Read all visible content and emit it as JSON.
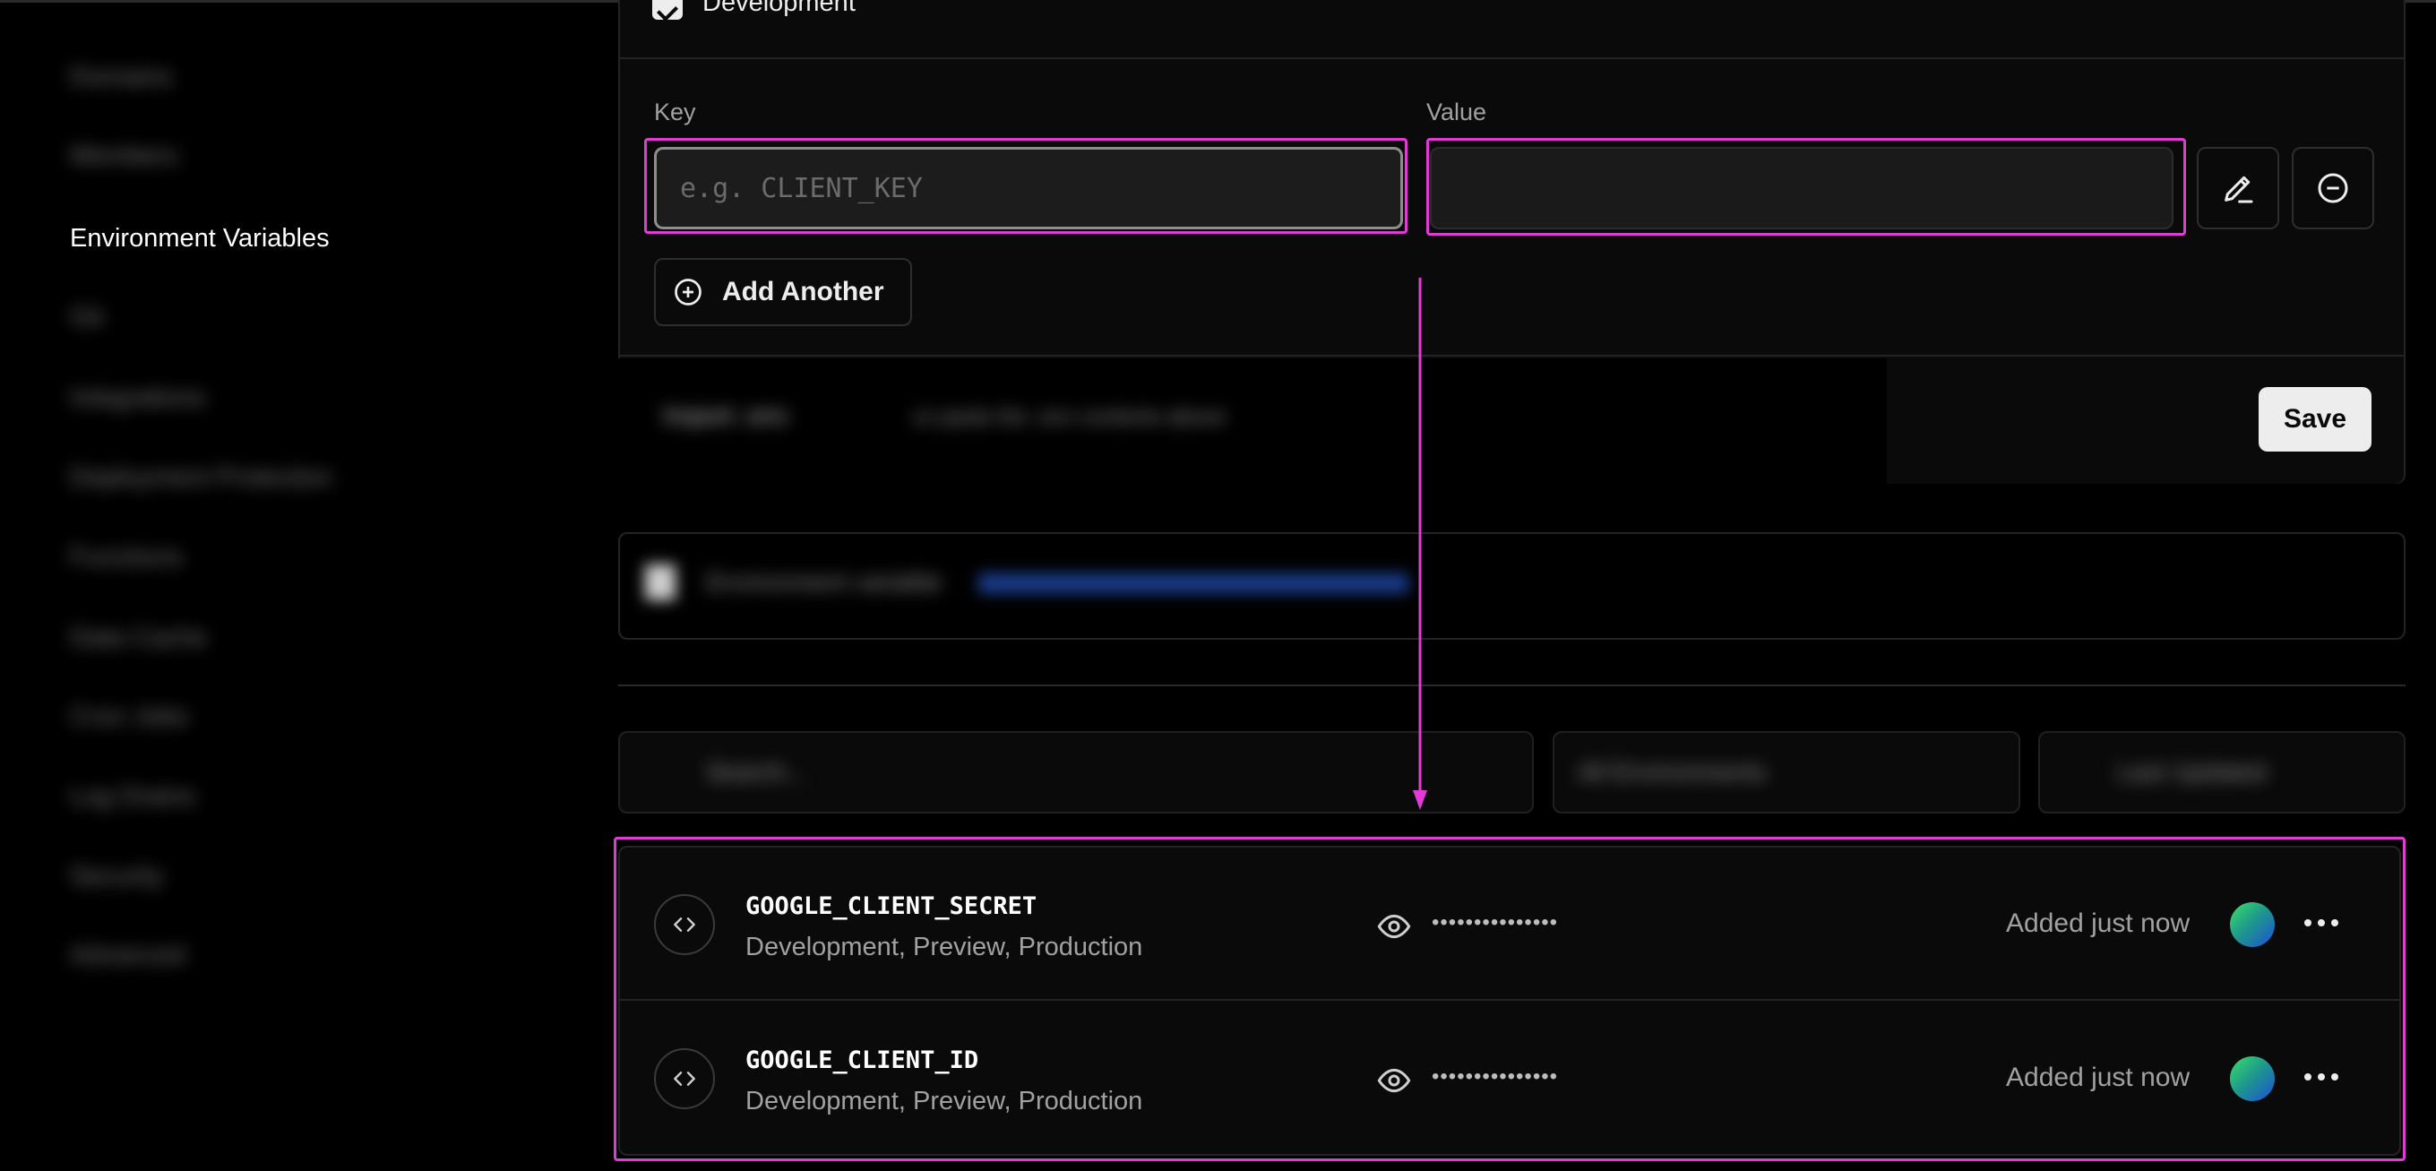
{
  "sidebar": {
    "items": [
      {
        "label": "Domains"
      },
      {
        "label": "Members"
      },
      {
        "label": "Environment Variables"
      },
      {
        "label": "Git"
      },
      {
        "label": "Integrations"
      },
      {
        "label": "Deployment Protection"
      },
      {
        "label": "Functions"
      },
      {
        "label": "Data Cache"
      },
      {
        "label": "Cron Jobs"
      },
      {
        "label": "Log Drains"
      },
      {
        "label": "Security"
      },
      {
        "label": "Advanced"
      }
    ],
    "active_index": 2
  },
  "form": {
    "environment_checkbox_label": "Development",
    "key_label": "Key",
    "value_label": "Value",
    "key_placeholder": "e.g. CLIENT_KEY",
    "key_value": "",
    "value_value": "",
    "add_another_label": "Add Another",
    "import_label": "Import .env",
    "import_hint": "or paste the .env contents above",
    "save_label": "Save"
  },
  "blurred": {
    "card2_text": "Environment variable",
    "search_placeholder": "Search...",
    "env_filter": "All Environments",
    "sort": "Last Updated"
  },
  "env_vars": [
    {
      "name": "GOOGLE_CLIENT_SECRET",
      "targets": "Development, Preview, Production",
      "masked": "•••••••••••••••",
      "added": "Added just now",
      "icon": "code-icon"
    },
    {
      "name": "GOOGLE_CLIENT_ID",
      "targets": "Development, Preview, Production",
      "masked": "•••••••••••••••",
      "added": "Added just now",
      "icon": "code-icon"
    }
  ],
  "colors": {
    "background": "#000000",
    "card": "#0a0a0a",
    "annotation": "#e23ad6",
    "text": "#ededed",
    "muted": "#a1a1a1"
  }
}
